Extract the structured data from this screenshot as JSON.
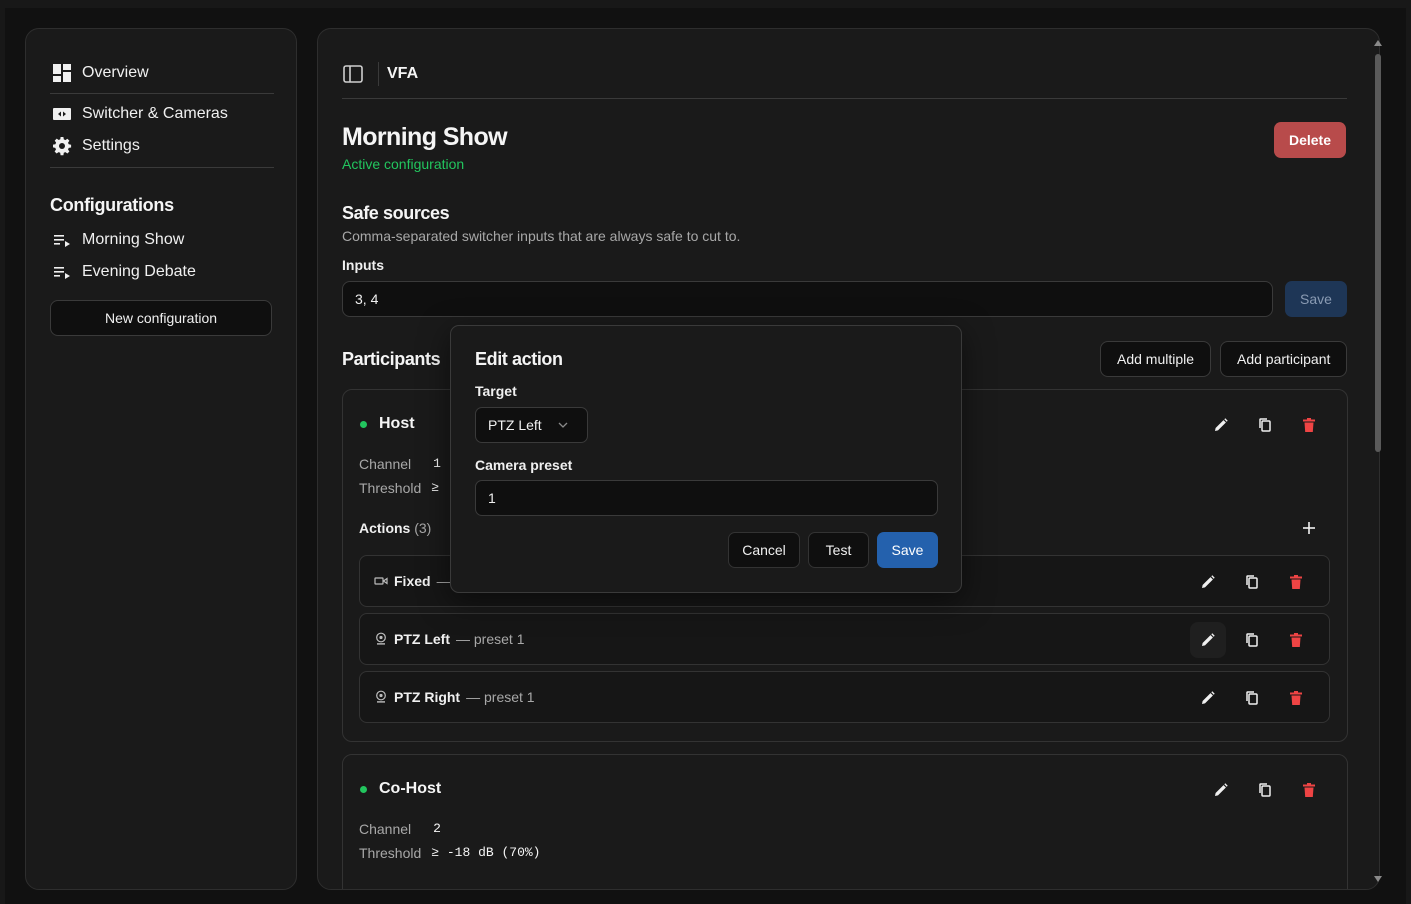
{
  "sidebar": {
    "nav": [
      {
        "label": "Overview",
        "icon": "dashboard-icon"
      },
      {
        "label": "Switcher & Cameras",
        "icon": "video-camera-icon"
      },
      {
        "label": "Settings",
        "icon": "gear-icon"
      }
    ],
    "configurations_heading": "Configurations",
    "configurations": [
      {
        "label": "Morning Show",
        "icon": "playlist-icon"
      },
      {
        "label": "Evening Debate",
        "icon": "playlist-icon"
      }
    ],
    "new_config_label": "New configuration"
  },
  "header": {
    "app_name": "VFA"
  },
  "config": {
    "title": "Morning Show",
    "status": "Active configuration",
    "delete_label": "Delete"
  },
  "safe_sources": {
    "title": "Safe sources",
    "description": "Comma-separated switcher inputs that are always safe to cut to.",
    "inputs_label": "Inputs",
    "inputs_value": "3, 4",
    "save_label": "Save"
  },
  "participants": {
    "title": "Participants",
    "add_multiple_label": "Add multiple",
    "add_participant_label": "Add participant",
    "list": [
      {
        "name": "Host",
        "channel_label": "Channel",
        "channel": "1",
        "threshold_label": "Threshold",
        "threshold": "≥",
        "actions_label": "Actions",
        "actions_count": "(3)",
        "actions": [
          {
            "name": "Fixed",
            "detail": "— i",
            "icon": "camera-icon"
          },
          {
            "name": "PTZ Left",
            "detail": "— preset 1",
            "icon": "webcam-icon"
          },
          {
            "name": "PTZ Right",
            "detail": "— preset 1",
            "icon": "webcam-icon"
          }
        ]
      },
      {
        "name": "Co-Host",
        "channel_label": "Channel",
        "channel": "2",
        "threshold_label": "Threshold",
        "threshold": "≥ -18 dB (70%)"
      }
    ]
  },
  "modal": {
    "title": "Edit action",
    "target_label": "Target",
    "target_value": "PTZ Left",
    "preset_label": "Camera preset",
    "preset_value": "1",
    "cancel_label": "Cancel",
    "test_label": "Test",
    "save_label": "Save"
  },
  "colors": {
    "accent_green": "#22c55e",
    "danger": "#b84b4b",
    "trash_red": "#ef4444",
    "primary_blue": "#2461ad"
  }
}
